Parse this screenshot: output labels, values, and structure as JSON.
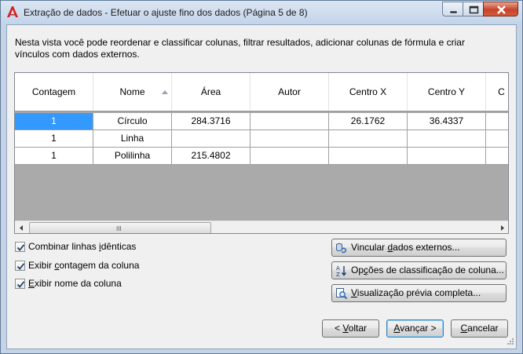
{
  "window": {
    "title": "Extração de dados - Efetuar o ajuste fino dos dados (Página 5 de 8)"
  },
  "description": "Nesta vista você pode reordenar e classificar colunas, filtrar resultados, adicionar colunas de fórmula e criar vínculos com dados externos.",
  "grid": {
    "columns": [
      "Contagem",
      "Nome",
      "Área",
      "Autor",
      "Centro X",
      "Centro Y",
      "C"
    ],
    "rows": [
      [
        "1",
        "Círculo",
        "284.3716",
        "",
        "26.1762",
        "36.4337",
        ""
      ],
      [
        "1",
        "Linha",
        "",
        "",
        "",
        "",
        ""
      ],
      [
        "1",
        "Polilinha",
        "215.4802",
        "",
        "",
        "",
        ""
      ]
    ],
    "sorted_column": "Nome",
    "selected_cell": "Contagem, row 1",
    "scroll_thumb_grip": "III"
  },
  "options": {
    "combine_identical": {
      "pre": "Combinar linhas ",
      "key": "i",
      "post": "dênticas",
      "checked": true
    },
    "show_count": {
      "pre": "Exibir ",
      "key": "c",
      "post": "ontagem da coluna",
      "checked": true
    },
    "show_name": {
      "pre": "",
      "key": "E",
      "post": "xibir nome da coluna",
      "checked": true
    }
  },
  "side_buttons": {
    "link_external": {
      "pre": "Vincular ",
      "key": "d",
      "post": "ados externos...",
      "icon": "link-data-icon"
    },
    "sort_options": {
      "pre": "Op",
      "key": "ç",
      "post": "ões de classificação de coluna...",
      "icon": "sort-az-icon"
    },
    "full_preview": {
      "pre": "",
      "key": "V",
      "post": "isualização prévia completa...",
      "icon": "preview-magnifier-icon"
    }
  },
  "nav_buttons": {
    "back": {
      "pre": "< ",
      "key": "V",
      "post": "oltar"
    },
    "next": {
      "pre": "",
      "key": "A",
      "post": "vançar >"
    },
    "cancel": {
      "pre": "",
      "key": "C",
      "post": "ancelar"
    }
  },
  "colors": {
    "selection": "#3399ff",
    "grid_empty": "#aaaaaa",
    "app_icon_red": "#d02020"
  }
}
